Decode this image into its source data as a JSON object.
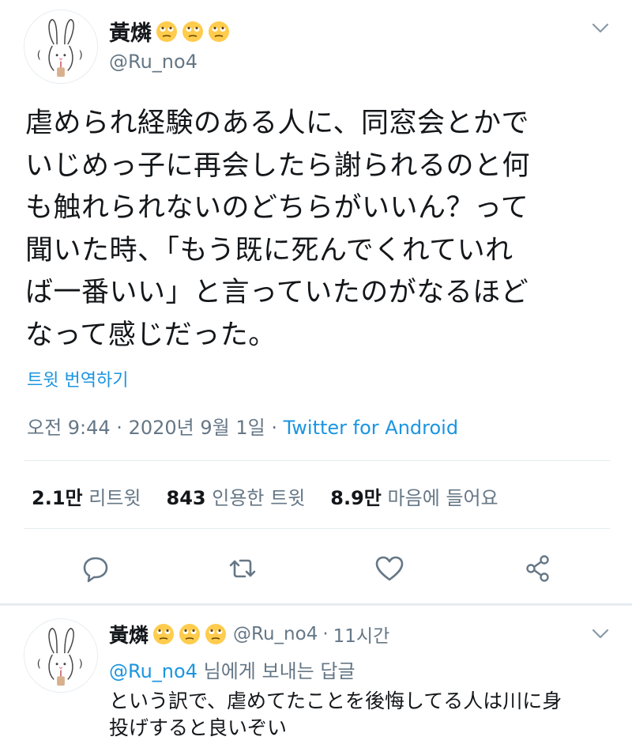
{
  "tweet": {
    "author_name": "黃燐",
    "author_emojis": [
      "face-with-rolling-eyes-icon",
      "face-with-rolling-eyes-icon",
      "face-with-rolling-eyes-icon"
    ],
    "author_handle": "@Ru_no4",
    "text_lines": [
      "虐められ経験のある人に、同窓会とかで",
      "いじめっ子に再会したら謝られるのと何",
      "も触れられないのどちらがいいん？って",
      "聞いた時、「もう既に死んでくれていれ",
      "ば一番いい」と言っていたのがなるほど",
      "なって感じだった。"
    ],
    "translate_label": "트윗 번역하기",
    "time": "오전 9:44 · 2020년 9월 1일 ·",
    "source": "Twitter for Android",
    "stats": {
      "retweets_count": "2.1만",
      "retweets_label": "리트윗",
      "quotes_count": "843",
      "quotes_label": "인용한 트윗",
      "likes_count": "8.9만",
      "likes_label": "마음에 들어요"
    },
    "actions": [
      "reply-icon",
      "retweet-icon",
      "like-icon",
      "share-icon"
    ]
  },
  "reply": {
    "author_name": "黃燐",
    "author_handle": "@Ru_no4",
    "dot": "·",
    "time": "11시간",
    "replying_to_mention": "@Ru_no4",
    "replying_to_suffix": "님에게 보내는 답글",
    "text_lines": [
      "という訳で、虐めてたことを後悔してる人は川に身",
      "投げすると良いぞい"
    ]
  },
  "colors": {
    "link_blue": "#1b95e0",
    "secondary_gray": "#657786",
    "divider": "#e6ecf0",
    "emoji_yellow": "#ffcc4d"
  }
}
